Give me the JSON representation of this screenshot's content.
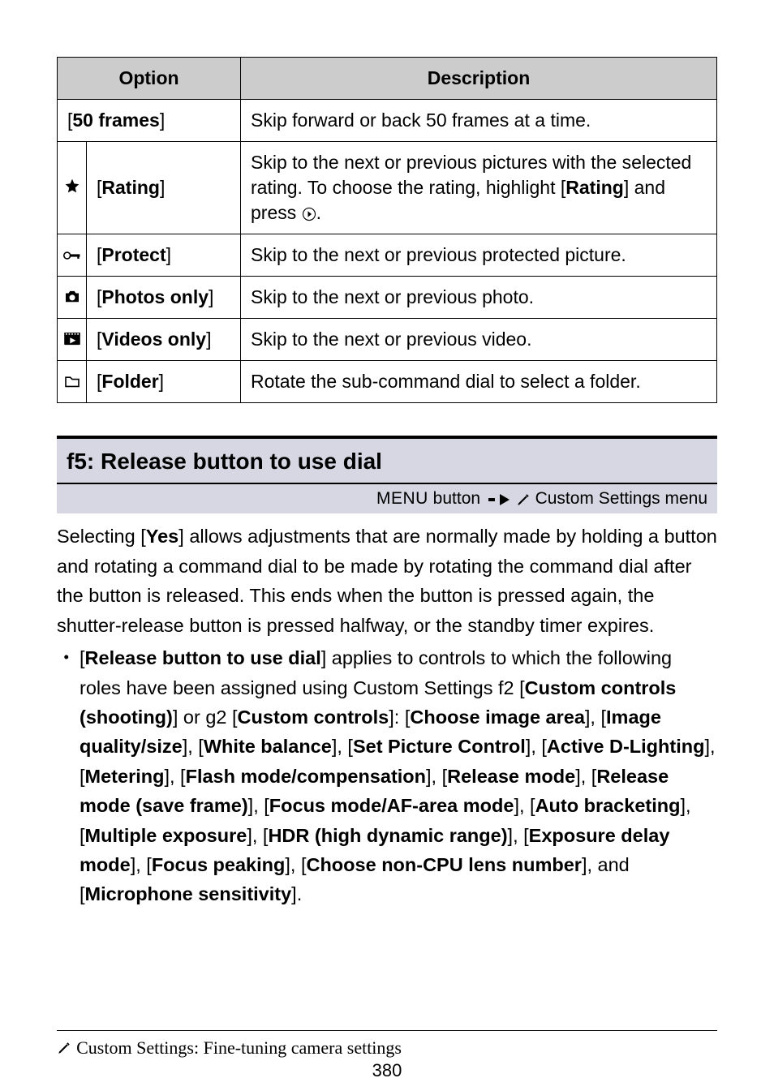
{
  "table": {
    "headers": {
      "option": "Option",
      "description": "Description"
    },
    "rows": [
      {
        "opt_full": "[50 frames]",
        "desc": "Skip forward or back 50 frames at a time."
      },
      {
        "icon": "star",
        "opt": "[Rating]",
        "desc_pre": "Skip to the next or previous pictures with the selected rating. To choose the rating, highlight [",
        "desc_bold": "Rating",
        "desc_mid": "] and press ",
        "desc_post": "."
      },
      {
        "icon": "key",
        "opt": "[Protect]",
        "desc": "Skip to the next or previous protected picture."
      },
      {
        "icon": "camera",
        "opt": "[Photos only]",
        "desc": "Skip to the next or previous photo."
      },
      {
        "icon": "video",
        "opt": "[Videos only]",
        "desc": "Skip to the next or previous video."
      },
      {
        "icon": "folder",
        "opt": "[Folder]",
        "desc": "Rotate the sub-command dial to select a folder."
      }
    ]
  },
  "section": {
    "heading": "f5: Release button to use dial",
    "sub_pre": "MENU",
    "sub_post_a": " button ",
    "sub_post_b": " Custom Settings menu"
  },
  "body": {
    "p1_a": "Selecting [",
    "p1_b": "Yes",
    "p1_c": "] allows adjustments that are normally made by holding a button and rotating a command dial to be made by rotating the command dial after the button is released. This ends when the button is pressed again, the shutter-release button is pressed halfway, or the standby timer expires.",
    "li_parts": [
      "[",
      "Release button to use dial",
      "] applies to controls to which the following roles have been assigned using Custom Settings f2 [",
      "Custom controls (shooting)",
      "] or g2 [",
      "Custom controls",
      "]: [",
      "Choose image area",
      "], [",
      "Image quality/size",
      "], [",
      "White balance",
      "], [",
      "Set Picture Control",
      "], [",
      "Active D-Lighting",
      "], [",
      "Metering",
      "], [",
      "Flash mode/compensation",
      "], [",
      "Release mode",
      "], [",
      "Release mode (save frame)",
      "], [",
      "Focus mode/AF-area mode",
      "], [",
      "Auto bracketing",
      "], [",
      "Multiple exposure",
      "], [",
      "HDR (high dynamic range)",
      "], [",
      "Exposure delay mode",
      "], [",
      "Focus peaking",
      "], [",
      "Choose non-CPU lens number",
      "], and [",
      "Microphone sensitivity",
      "]."
    ]
  },
  "footer": {
    "left": "Custom Settings: Fine-tuning camera settings",
    "page": "380"
  }
}
